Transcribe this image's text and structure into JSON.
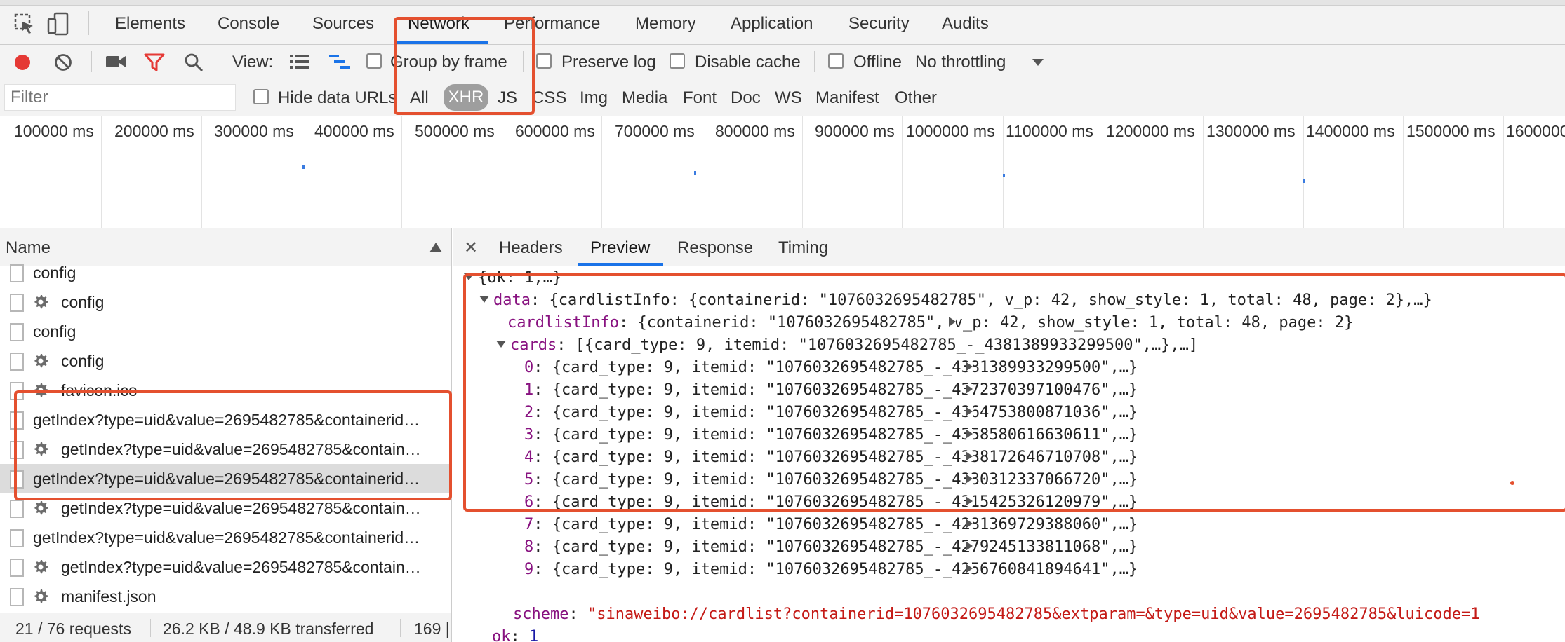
{
  "tabs": [
    "Elements",
    "Console",
    "Sources",
    "Network",
    "Performance",
    "Memory",
    "Application",
    "Security",
    "Audits"
  ],
  "active_tab": "Network",
  "toolbar": {
    "view_label": "View:",
    "group_by_frame": "Group by frame",
    "preserve_log": "Preserve log",
    "disable_cache": "Disable cache",
    "offline": "Offline",
    "throttling": "No throttling"
  },
  "filter": {
    "placeholder": "Filter",
    "hide_data_urls": "Hide data URLs",
    "types": [
      "All",
      "XHR",
      "JS",
      "CSS",
      "Img",
      "Media",
      "Font",
      "Doc",
      "WS",
      "Manifest",
      "Other"
    ],
    "active_type": "XHR"
  },
  "timeline": {
    "ticks": [
      "100000 ms",
      "200000 ms",
      "300000 ms",
      "400000 ms",
      "500000 ms",
      "600000 ms",
      "700000 ms",
      "800000 ms",
      "900000 ms",
      "1000000 ms",
      "1100000 ms",
      "1200000 ms",
      "1300000 ms",
      "1400000 ms",
      "1500000 ms",
      "1600000"
    ]
  },
  "request_list": {
    "header": "Name",
    "rows": [
      {
        "label": "config",
        "gear": false
      },
      {
        "label": "config",
        "gear": true
      },
      {
        "label": "config",
        "gear": false
      },
      {
        "label": "config",
        "gear": true
      },
      {
        "label": "favicon.ico",
        "gear": true
      },
      {
        "label": "getIndex?type=uid&value=2695482785&containerid…",
        "gear": false
      },
      {
        "label": "getIndex?type=uid&value=2695482785&contain…",
        "gear": true
      },
      {
        "label": "getIndex?type=uid&value=2695482785&containerid…",
        "gear": false,
        "selected": true
      },
      {
        "label": "getIndex?type=uid&value=2695482785&contain…",
        "gear": true
      },
      {
        "label": "getIndex?type=uid&value=2695482785&containerid…",
        "gear": false
      },
      {
        "label": "getIndex?type=uid&value=2695482785&contain…",
        "gear": true
      },
      {
        "label": "manifest.json",
        "gear": true
      }
    ]
  },
  "status": {
    "requests": "21 / 76 requests",
    "transferred": "26.2 KB / 48.9 KB transferred",
    "extra": "169 |"
  },
  "detail_tabs": [
    "Headers",
    "Preview",
    "Response",
    "Timing"
  ],
  "active_detail_tab": "Preview",
  "preview": {
    "root": "{ok: 1,…}",
    "data_key": "data",
    "data_summary": "{cardlistInfo: {containerid: \"1076032695482785\", v_p: 42, show_style: 1, total: 48, page: 2},…}",
    "cardlistinfo_key": "cardlistInfo",
    "cardlistinfo_value": "{containerid: \"1076032695482785\", v_p: 42, show_style: 1, total: 48, page: 2}",
    "cards_key": "cards",
    "cards_summary": "[{card_type: 9, itemid: \"1076032695482785_-_4381389933299500\",…},…]",
    "cards": [
      {
        "index": "0",
        "itemid": "1076032695482785_-_4381389933299500"
      },
      {
        "index": "1",
        "itemid": "1076032695482785_-_4372370397100476"
      },
      {
        "index": "2",
        "itemid": "1076032695482785_-_4364753800871036"
      },
      {
        "index": "3",
        "itemid": "1076032695482785_-_4358580616630611"
      },
      {
        "index": "4",
        "itemid": "1076032695482785_-_4338172646710708"
      },
      {
        "index": "5",
        "itemid": "1076032695482785_-_4330312337066720"
      },
      {
        "index": "6",
        "itemid": "1076032695482785_-_4315425326120979"
      },
      {
        "index": "7",
        "itemid": "1076032695482785_-_4281369729388060"
      },
      {
        "index": "8",
        "itemid": "1076032695482785_-_4279245133811068"
      },
      {
        "index": "9",
        "itemid": "1076032695482785_-_4256760841894641"
      }
    ],
    "card_type": "9",
    "scheme_key": "scheme",
    "scheme_value": "\"sinaweibo://cardlist?containerid=1076032695482785&extparam=&type=uid&value=2695482785&luicode=1",
    "ok_key": "ok",
    "ok_value": "1"
  },
  "colors": {
    "annotation": "#e4502f",
    "accent": "#1a73e8",
    "record": "#e53935",
    "filter_icon": "#e53935"
  }
}
